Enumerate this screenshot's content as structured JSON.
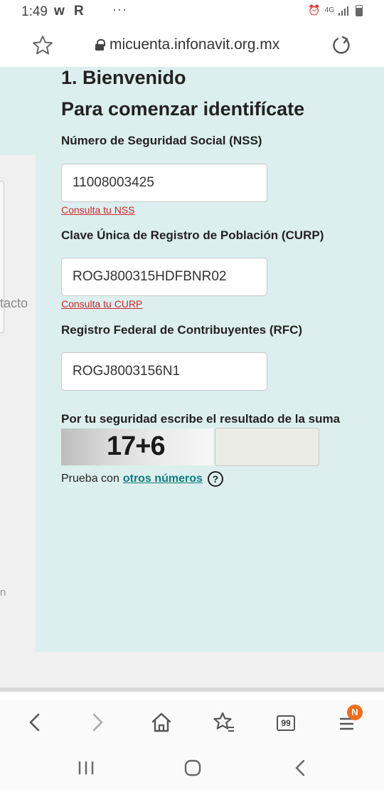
{
  "status_bar": {
    "time": "1:49",
    "apps": "w R",
    "more": "···",
    "network": "4G"
  },
  "browser": {
    "url": "micuenta.infonavit.org.mx",
    "tab_count": "99",
    "notification_badge": "N"
  },
  "form": {
    "step_title": "1. Bienvenido",
    "subtitle": "Para comenzar identifícate",
    "nss_label": "Número de Seguridad Social (NSS)",
    "nss_value": "11008003425",
    "nss_link": "Consulta tu NSS",
    "curp_label": "Clave Única de Registro de Población (CURP)",
    "curp_value": "ROGJ800315HDFBNR02",
    "curp_link": "Consulta tu CURP",
    "rfc_label": "Registro Federal de Contribuyentes (RFC)",
    "rfc_value": "ROGJ8003156N1",
    "captcha_label": "Por tu seguridad escribe el resultado de la suma",
    "captcha_text": "17+6",
    "captcha_answer": "",
    "retry_prefix": "Prueba con",
    "retry_link": "otros números",
    "help_glyph": "?"
  },
  "side": {
    "partial_label": "tacto",
    "partial_fragment": "n"
  },
  "colors": {
    "teal_background": "#dcefee",
    "link_red": "#d0262c",
    "link_teal": "#0f7c80",
    "badge_orange": "#ef6c1a"
  }
}
